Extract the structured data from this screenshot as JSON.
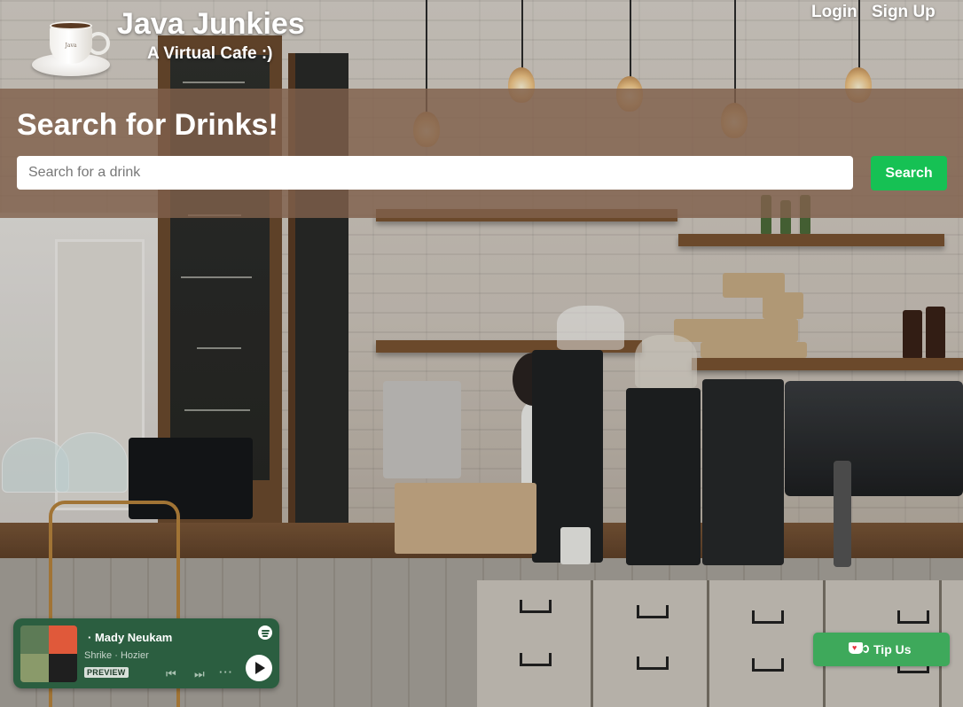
{
  "header": {
    "site_title": "Java Junkies",
    "site_subtitle": "A Virtual Cafe :)",
    "logo_cup_text": "Java",
    "nav": {
      "login": "Login",
      "signup": "Sign Up"
    }
  },
  "search": {
    "heading": "Search for Drinks!",
    "placeholder": "Search for a drink",
    "button_label": "Search"
  },
  "player": {
    "artist_line": "· Mady Neukam",
    "track": "Shrike",
    "track_artist": "Hozier",
    "badge": "PREVIEW",
    "icons": [
      "spotify-icon",
      "previous-track-icon",
      "next-track-icon",
      "more-icon",
      "play-icon"
    ]
  },
  "tip": {
    "label": "Tip Us",
    "icon": "coffee-cup-heart-icon"
  },
  "colors": {
    "search_band": "#80604c",
    "search_button": "#16c154",
    "player_bg": "#2b5e40",
    "tip_button": "#3ea95b"
  }
}
